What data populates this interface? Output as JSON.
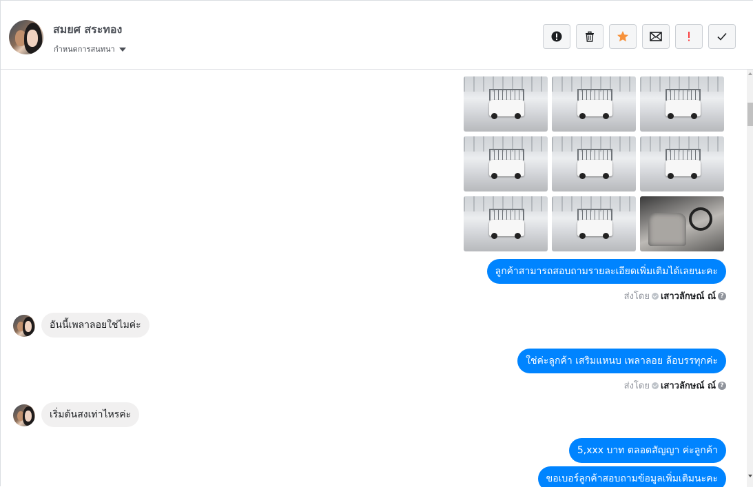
{
  "header": {
    "name": "สมยศ สระทอง",
    "subtitle": "กำหนดการสนทนา",
    "actions": [
      {
        "name": "alert-circle-icon",
        "label": "Report"
      },
      {
        "name": "trash-icon",
        "label": "Delete"
      },
      {
        "name": "star-icon",
        "label": "Star",
        "color": "#f7923b"
      },
      {
        "name": "envelope-icon",
        "label": "Unread"
      },
      {
        "name": "exclamation-icon",
        "label": "Follow up",
        "color": "#fa3e3e"
      },
      {
        "name": "check-icon",
        "label": "Done"
      }
    ]
  },
  "messages": [
    {
      "type": "photos",
      "count": 9,
      "subjects": [
        "truck-front-left",
        "truck-rear",
        "truck-front-right",
        "truck-front",
        "truck-rear-center",
        "truck-rear-right",
        "truck-side-left",
        "truck-side-right",
        "truck-interior"
      ]
    },
    {
      "type": "outgoing",
      "text": "ลูกค้าสามารถสอบถามรายละเอียดเพิ่มเติมได้เลยนะคะ",
      "sent_by_label": "ส่งโดย",
      "sender": "เสาวลักษณ์ ณ์"
    },
    {
      "type": "incoming",
      "text": "อันนี้เพลาลอยใช่ไมค่ะ"
    },
    {
      "type": "outgoing",
      "text": "ใช่ค่ะลูกค้า เสริมแหนบ เพลาลอย ล้อบรรทุกค่ะ",
      "sent_by_label": "ส่งโดย",
      "sender": "เสาวลักษณ์ ณ์"
    },
    {
      "type": "incoming",
      "text": "เริ่มต้นสงเท่าไหรค่ะ"
    },
    {
      "type": "outgoing",
      "text": "5,xxx บาท ตลอดสัญญา ค่ะลูกค้า"
    },
    {
      "type": "outgoing",
      "text": "ขอเบอร์ลูกค้าสอบถามข้อมูลเพิ่มเติมนะคะ"
    }
  ],
  "colors": {
    "outgoing_bubble": "#0084ff",
    "incoming_bubble": "#f1f0f0",
    "border": "#dadde1"
  }
}
